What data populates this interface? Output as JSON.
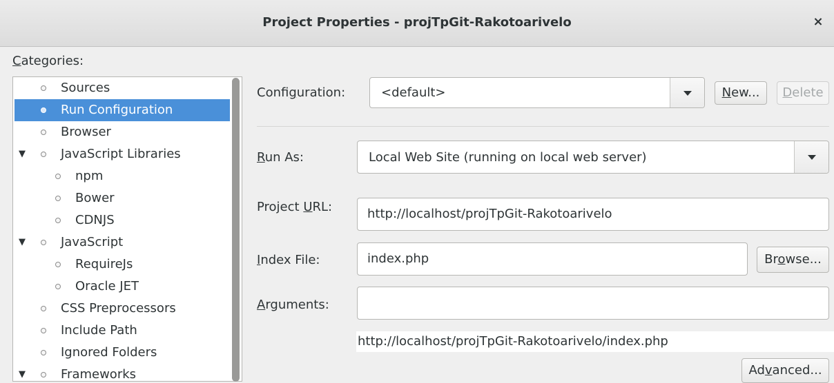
{
  "window": {
    "title": "Project Properties - projTpGit-Rakotoarivelo",
    "close_glyph": "×"
  },
  "categories": {
    "label_mnemonic": "C",
    "label_rest": "ategories:",
    "items": [
      {
        "label": "Sources",
        "expander": ""
      },
      {
        "label": "Run Configuration",
        "expander": ""
      },
      {
        "label": "Browser",
        "expander": ""
      },
      {
        "label": "JavaScript Libraries",
        "expander": "▼"
      },
      {
        "label": "npm",
        "expander": ""
      },
      {
        "label": "Bower",
        "expander": ""
      },
      {
        "label": "CDNJS",
        "expander": ""
      },
      {
        "label": "JavaScript",
        "expander": "▼"
      },
      {
        "label": "RequireJs",
        "expander": ""
      },
      {
        "label": "Oracle JET",
        "expander": ""
      },
      {
        "label": "CSS Preprocessors",
        "expander": ""
      },
      {
        "label": "Include Path",
        "expander": ""
      },
      {
        "label": "Ignored Folders",
        "expander": ""
      },
      {
        "label": "Frameworks",
        "expander": "▼"
      }
    ]
  },
  "configuration": {
    "label_a": "Confi",
    "label_m": "g",
    "label_b": "uration:",
    "value": "<default>",
    "new_m": "N",
    "new_rest": "ew...",
    "delete_m": "D",
    "delete_rest": "elete"
  },
  "run_as": {
    "label_m": "R",
    "label_rest": "un As:",
    "value": "Local Web Site (running on local web server)"
  },
  "project_url": {
    "label_a": "Project ",
    "label_m": "U",
    "label_b": "RL:",
    "value": "http://localhost/projTpGit-Rakotoarivelo"
  },
  "index_file": {
    "label_m": "I",
    "label_rest": "ndex File:",
    "value": "index.php",
    "browse_a": "Br",
    "browse_m": "o",
    "browse_b": "wse..."
  },
  "arguments": {
    "label_m": "A",
    "label_rest": "rguments:",
    "value": ""
  },
  "url_preview": "http://localhost/projTpGit-Rakotoarivelo/index.php",
  "advanced": {
    "a": "Ad",
    "m": "v",
    "b": "anced..."
  }
}
